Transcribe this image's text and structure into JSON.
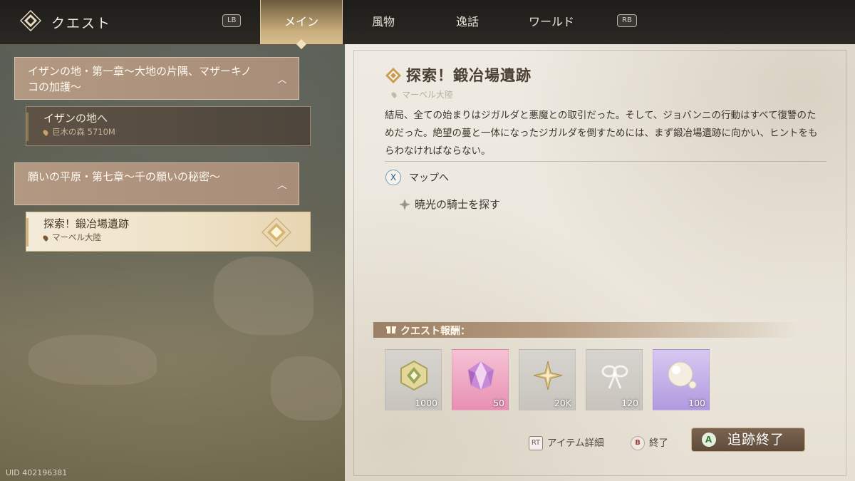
{
  "header": {
    "title": "クエスト",
    "lb_label": "LB",
    "rb_label": "RB",
    "tabs": [
      {
        "label": "メイン",
        "active": true
      },
      {
        "label": "風物",
        "active": false
      },
      {
        "label": "逸話",
        "active": false
      },
      {
        "label": "ワールド",
        "active": false
      }
    ]
  },
  "quest_list": {
    "chapters": [
      {
        "title": "イザンの地・第一章〜大地の片隅、マザーキノコの加護〜",
        "quests": [
          {
            "name": "イザンの地へ",
            "location": "巨木の森 5710M"
          }
        ]
      },
      {
        "title": "願いの平原・第七章〜千の願いの秘密〜",
        "quests": [
          {
            "name": "探索！鍛冶場遺跡",
            "location": "マーベル大陸",
            "selected": true
          }
        ]
      }
    ]
  },
  "detail": {
    "title": "探索！鍛冶場遺跡",
    "location": "マーベル大陸",
    "description": "結局、全ての始まりはジガルダと悪魔との取引だった。そして、ジョバンニの行動はすべて復讐のためだった。絶望の蔓と一体になったジガルダを倒すためには、まず鍛冶場遺跡に向かい、ヒントをもらわなければならない。",
    "map_key": "X",
    "map_label": "マップへ",
    "objective": "暁光の騎士を探す"
  },
  "rewards": {
    "header": "クエスト報酬：",
    "items": [
      {
        "icon": "hexagon-emblem-icon",
        "amount": "1000",
        "style": "gray"
      },
      {
        "icon": "pink-crystal-icon",
        "amount": "50",
        "style": "pink"
      },
      {
        "icon": "gold-star-icon",
        "amount": "20K",
        "style": "gray"
      },
      {
        "icon": "white-ribbon-icon",
        "amount": "120",
        "style": "gray"
      },
      {
        "icon": "pearl-orb-icon",
        "amount": "100",
        "style": "purple"
      }
    ]
  },
  "footer": {
    "rt_key": "RT",
    "item_detail_label": "アイテム詳細",
    "b_key": "B",
    "close_label": "終了",
    "a_key": "A",
    "track_end_label": "追跡終了",
    "uid": "UID 402196381"
  },
  "colors": {
    "accent_gold": "#d8be8e",
    "chapter_bg": "#b39882",
    "parchment": "#ece7dd"
  }
}
